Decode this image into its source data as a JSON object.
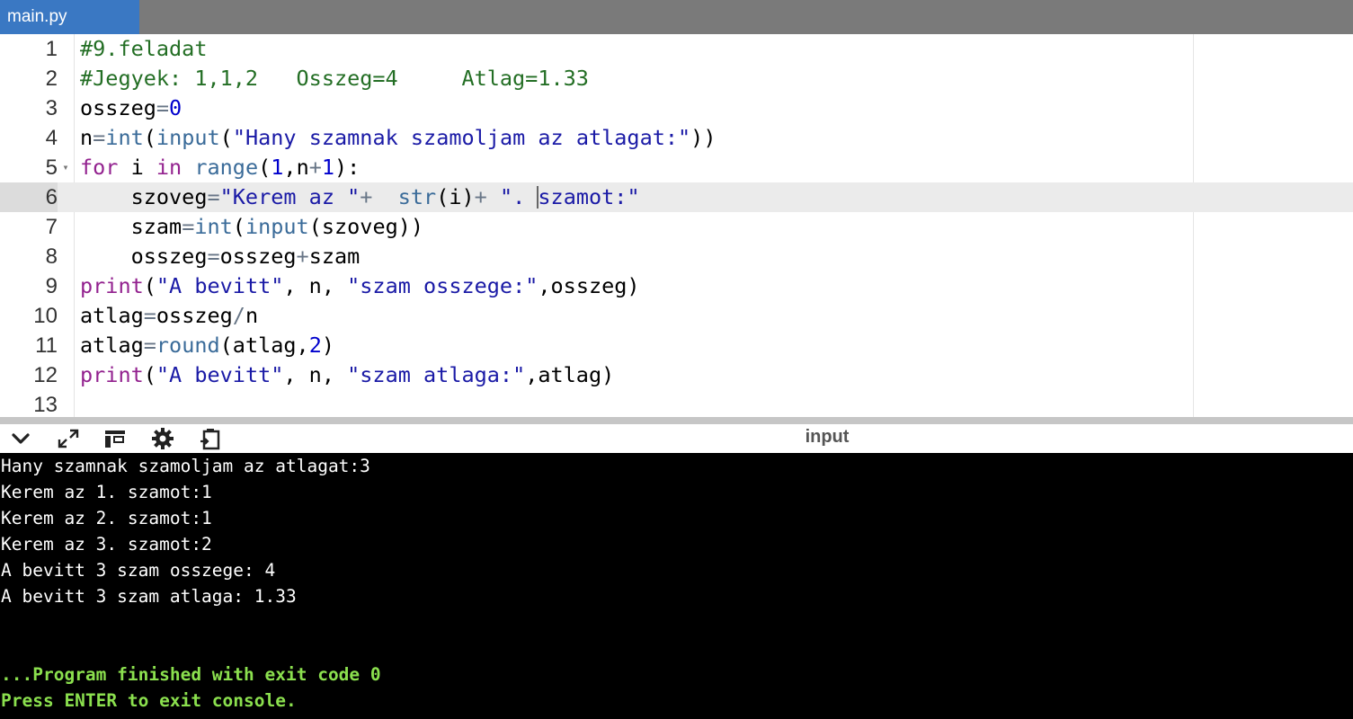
{
  "tab": {
    "label": "main.py"
  },
  "editor": {
    "active_line": 6,
    "fold_marker": "▾",
    "lines": [
      {
        "num": "1",
        "tokens": [
          {
            "t": "comment",
            "v": "#9.feladat"
          }
        ]
      },
      {
        "num": "2",
        "tokens": [
          {
            "t": "comment",
            "v": "#Jegyek: 1,1,2   Osszeg=4     Atlag=1.33"
          }
        ]
      },
      {
        "num": "3",
        "tokens": [
          {
            "t": "id",
            "v": "osszeg"
          },
          {
            "t": "op",
            "v": "="
          },
          {
            "t": "num",
            "v": "0"
          }
        ]
      },
      {
        "num": "4",
        "tokens": [
          {
            "t": "id",
            "v": "n"
          },
          {
            "t": "op",
            "v": "="
          },
          {
            "t": "builtin",
            "v": "int"
          },
          {
            "t": "id",
            "v": "("
          },
          {
            "t": "builtin",
            "v": "input"
          },
          {
            "t": "id",
            "v": "("
          },
          {
            "t": "str",
            "v": "\"Hany szamnak szamoljam az atlagat:\""
          },
          {
            "t": "id",
            "v": "))"
          }
        ]
      },
      {
        "num": "5",
        "fold": true,
        "tokens": [
          {
            "t": "kw",
            "v": "for"
          },
          {
            "t": "id",
            "v": " i "
          },
          {
            "t": "kw",
            "v": "in"
          },
          {
            "t": "id",
            "v": " "
          },
          {
            "t": "builtin",
            "v": "range"
          },
          {
            "t": "id",
            "v": "("
          },
          {
            "t": "num",
            "v": "1"
          },
          {
            "t": "id",
            "v": ",n"
          },
          {
            "t": "op",
            "v": "+"
          },
          {
            "t": "num",
            "v": "1"
          },
          {
            "t": "id",
            "v": "):"
          }
        ]
      },
      {
        "num": "6",
        "tokens": [
          {
            "t": "id",
            "v": "    szoveg"
          },
          {
            "t": "op",
            "v": "="
          },
          {
            "t": "str",
            "v": "\"Kerem az \""
          },
          {
            "t": "op",
            "v": "+"
          },
          {
            "t": "id",
            "v": "  "
          },
          {
            "t": "builtin",
            "v": "str"
          },
          {
            "t": "id",
            "v": "(i)"
          },
          {
            "t": "op",
            "v": "+"
          },
          {
            "t": "id",
            "v": " "
          },
          {
            "t": "str",
            "v": "\". "
          },
          {
            "t": "cursor",
            "v": ""
          },
          {
            "t": "str",
            "v": "szamot:\""
          }
        ]
      },
      {
        "num": "7",
        "tokens": [
          {
            "t": "id",
            "v": "    szam"
          },
          {
            "t": "op",
            "v": "="
          },
          {
            "t": "builtin",
            "v": "int"
          },
          {
            "t": "id",
            "v": "("
          },
          {
            "t": "builtin",
            "v": "input"
          },
          {
            "t": "id",
            "v": "(szoveg))"
          }
        ]
      },
      {
        "num": "8",
        "tokens": [
          {
            "t": "id",
            "v": "    osszeg"
          },
          {
            "t": "op",
            "v": "="
          },
          {
            "t": "id",
            "v": "osszeg"
          },
          {
            "t": "op",
            "v": "+"
          },
          {
            "t": "id",
            "v": "szam"
          }
        ]
      },
      {
        "num": "9",
        "tokens": [
          {
            "t": "kw",
            "v": "print"
          },
          {
            "t": "id",
            "v": "("
          },
          {
            "t": "str",
            "v": "\"A bevitt\""
          },
          {
            "t": "id",
            "v": ", n, "
          },
          {
            "t": "str",
            "v": "\"szam osszege:\""
          },
          {
            "t": "id",
            "v": ",osszeg)"
          }
        ]
      },
      {
        "num": "10",
        "tokens": [
          {
            "t": "id",
            "v": "atlag"
          },
          {
            "t": "op",
            "v": "="
          },
          {
            "t": "id",
            "v": "osszeg"
          },
          {
            "t": "op",
            "v": "/"
          },
          {
            "t": "id",
            "v": "n"
          }
        ]
      },
      {
        "num": "11",
        "tokens": [
          {
            "t": "id",
            "v": "atlag"
          },
          {
            "t": "op",
            "v": "="
          },
          {
            "t": "builtin",
            "v": "round"
          },
          {
            "t": "id",
            "v": "(atlag,"
          },
          {
            "t": "num",
            "v": "2"
          },
          {
            "t": "id",
            "v": ")"
          }
        ]
      },
      {
        "num": "12",
        "tokens": [
          {
            "t": "kw",
            "v": "print"
          },
          {
            "t": "id",
            "v": "("
          },
          {
            "t": "str",
            "v": "\"A bevitt\""
          },
          {
            "t": "id",
            "v": ", n, "
          },
          {
            "t": "str",
            "v": "\"szam atlaga:\""
          },
          {
            "t": "id",
            "v": ",atlag)"
          }
        ]
      },
      {
        "num": "13",
        "tokens": []
      }
    ]
  },
  "toolbar": {
    "icons": [
      "chevron-down-icon",
      "expand-icon",
      "layout-icon",
      "gear-icon",
      "clipboard-icon"
    ],
    "title": "input"
  },
  "console": {
    "lines": [
      {
        "text": "Hany szamnak szamoljam az atlagat:3",
        "style": "normal"
      },
      {
        "text": "Kerem az 1. szamot:1",
        "style": "normal"
      },
      {
        "text": "Kerem az 2. szamot:1",
        "style": "normal"
      },
      {
        "text": "Kerem az 3. szamot:2",
        "style": "normal"
      },
      {
        "text": "A bevitt 3 szam osszege: 4",
        "style": "normal"
      },
      {
        "text": "A bevitt 3 szam atlaga: 1.33",
        "style": "normal"
      },
      {
        "text": "",
        "style": "normal"
      },
      {
        "text": "",
        "style": "normal"
      },
      {
        "text": "...Program finished with exit code 0",
        "style": "green"
      },
      {
        "text": "Press ENTER to exit console.",
        "style": "green"
      }
    ]
  },
  "colors": {
    "tab_active": "#3a78c3",
    "tabbar": "#7a7a7a",
    "console_bg": "#000000",
    "console_finish": "#8be04e",
    "comment": "#236e24",
    "keyword": "#93228f",
    "string": "#1a1aa6",
    "number": "#0000cd"
  }
}
